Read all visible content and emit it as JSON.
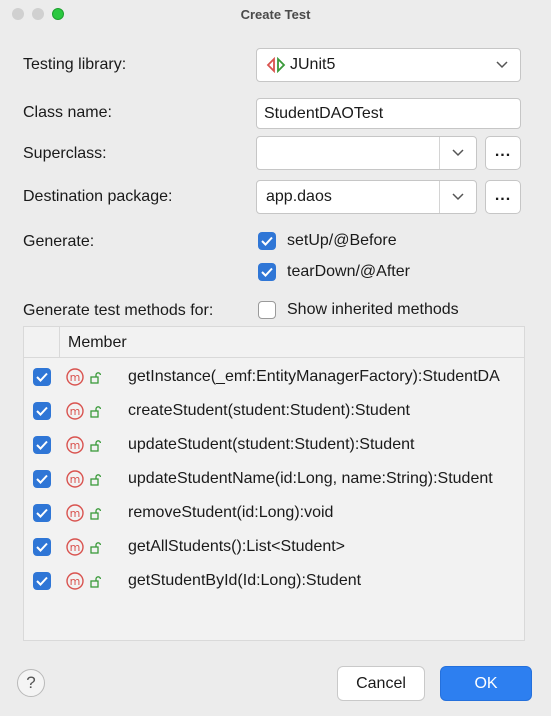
{
  "window": {
    "title": "Create Test"
  },
  "form": {
    "testing_library_label": "Testing library:",
    "testing_library_value": "JUnit5",
    "class_name_label": "Class name:",
    "class_name_value": "StudentDAOTest",
    "superclass_label": "Superclass:",
    "superclass_value": "",
    "destination_label": "Destination package:",
    "destination_value": "app.daos",
    "browse_label": "...",
    "generate_label": "Generate:",
    "setup_label": "setUp/@Before",
    "teardown_label": "tearDown/@After",
    "methods_for_label": "Generate test methods for:",
    "show_inherited_label": "Show inherited methods"
  },
  "table": {
    "header": "Member",
    "rows": [
      {
        "signature": "getInstance(_emf:EntityManagerFactory):StudentDA",
        "checked": true
      },
      {
        "signature": "createStudent(student:Student):Student",
        "checked": true
      },
      {
        "signature": "updateStudent(student:Student):Student",
        "checked": true
      },
      {
        "signature": "updateStudentName(id:Long, name:String):Student",
        "checked": true
      },
      {
        "signature": "removeStudent(id:Long):void",
        "checked": true
      },
      {
        "signature": "getAllStudents():List<Student>",
        "checked": true
      },
      {
        "signature": "getStudentById(Id:Long):Student",
        "checked": true
      }
    ]
  },
  "footer": {
    "help_label": "?",
    "cancel_label": "Cancel",
    "ok_label": "OK"
  },
  "colors": {
    "accent": "#2d7ff0",
    "checkbox": "#2f76d6",
    "method_icon": "#d9534f",
    "lock_icon": "#3a9a3a"
  }
}
